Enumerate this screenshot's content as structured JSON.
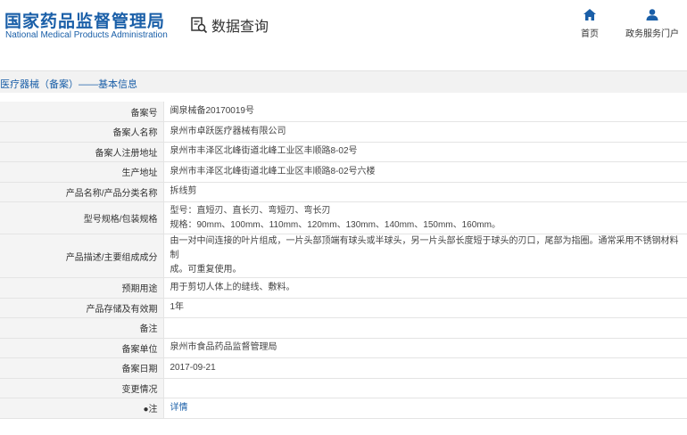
{
  "header": {
    "logo_cn": "国家药品监督管理局",
    "logo_en": "National Medical Products Administration",
    "query_label": "数据查询",
    "query_icon": "search-doc-icon",
    "nav": {
      "home_label": "首页",
      "portal_label": "政务服务门户"
    },
    "accent_color": "#1a5fa8"
  },
  "section": {
    "title": "医疗器械（备案）——基本信息"
  },
  "rows": [
    {
      "label": "备案号",
      "value": "闽泉械备20170019号"
    },
    {
      "label": "备案人名称",
      "value": "泉州市卓跃医疗器械有限公司"
    },
    {
      "label": "备案人注册地址",
      "value": "泉州市丰泽区北峰街道北峰工业区丰顺路8-02号"
    },
    {
      "label": "生产地址",
      "value": "泉州市丰泽区北峰街道北峰工业区丰顺路8-02号六楼"
    },
    {
      "label": "产品名称/产品分类名称",
      "value": "拆线剪"
    },
    {
      "label": "型号规格/包装规格",
      "value_line1": "型号：直短刃、直长刃、弯短刃、弯长刃",
      "value_line2": "规格：90mm、100mm、110mm、120mm、130mm、140mm、150mm、160mm。"
    },
    {
      "label": "产品描述/主要组成成分",
      "value_line1": "由一对中间连接的叶片组成，一片头部顶端有球头或半球头，另一片头部长度短于球头的刃口，尾部为指圈。通常采用不锈钢材料制",
      "value_line2": "成。可重复使用。"
    },
    {
      "label": "预期用途",
      "value": "用于剪切人体上的缝线、敷料。"
    },
    {
      "label": "产品存储及有效期",
      "value": "1年"
    },
    {
      "label": "备注",
      "value": ""
    },
    {
      "label": "备案单位",
      "value": "泉州市食品药品监督管理局"
    },
    {
      "label": "备案日期",
      "value": "2017-09-21"
    },
    {
      "label": "变更情况",
      "value": ""
    },
    {
      "label": "●注",
      "value": "详情"
    }
  ]
}
